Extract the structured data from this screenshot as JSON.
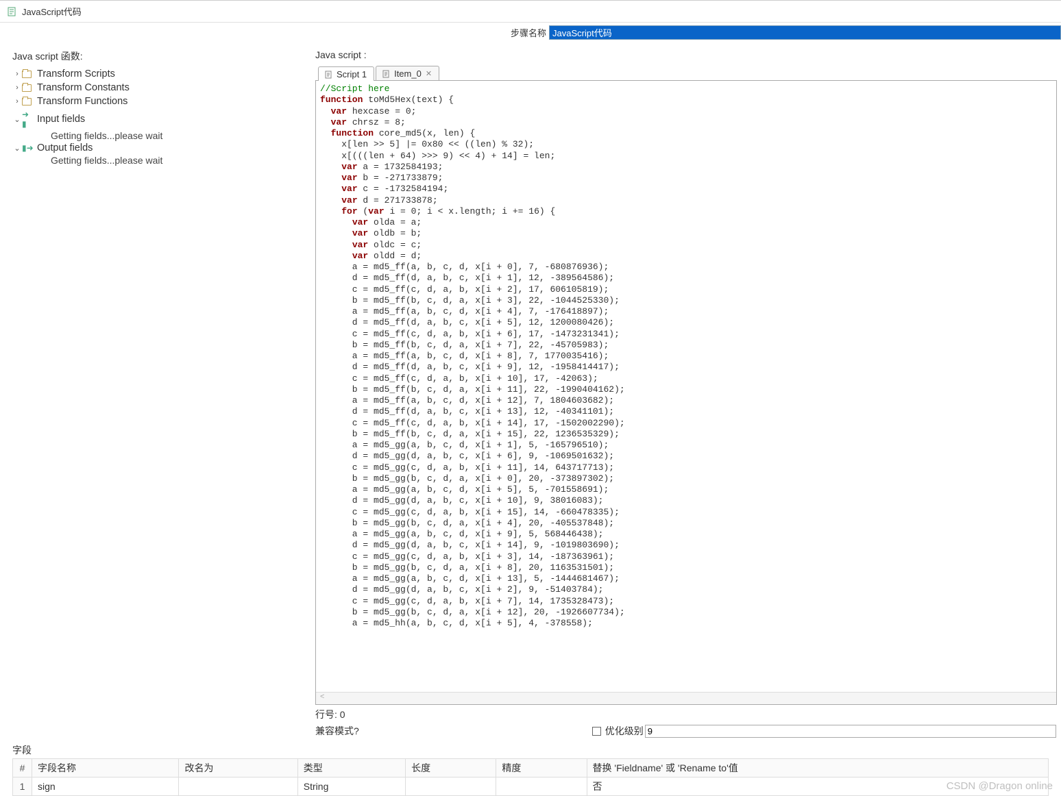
{
  "window": {
    "title": "JavaScript代码"
  },
  "step": {
    "label": "步骤名称",
    "value": "JavaScript代码"
  },
  "left": {
    "heading": "Java script 函数:",
    "tree": [
      {
        "label": "Transform Scripts",
        "expanded": false,
        "type": "folder"
      },
      {
        "label": "Transform Constants",
        "expanded": false,
        "type": "folder"
      },
      {
        "label": "Transform Functions",
        "expanded": false,
        "type": "folder"
      },
      {
        "label": "Input fields",
        "expanded": true,
        "type": "input",
        "child": "Getting fields...please wait"
      },
      {
        "label": "Output fields",
        "expanded": true,
        "type": "output",
        "child": "Getting fields...please wait"
      }
    ]
  },
  "right": {
    "heading": "Java script :",
    "tabs": [
      {
        "label": "Script 1",
        "active": true,
        "closable": false
      },
      {
        "label": "Item_0",
        "active": false,
        "closable": true
      }
    ],
    "code_lines": [
      {
        "t": "//Script here",
        "cls": "c-comment"
      },
      {
        "t": "",
        "cls": ""
      },
      {
        "t": "function toMd5Hex(text) {",
        "cls": "kw-line",
        "kw": "function"
      },
      {
        "t": "  var hexcase = 0;",
        "cls": "kw-line",
        "kw": "var"
      },
      {
        "t": "  var chrsz = 8;",
        "cls": "kw-line",
        "kw": "var"
      },
      {
        "t": "",
        "cls": ""
      },
      {
        "t": "  function core_md5(x, len) {",
        "cls": "kw-line",
        "kw": "function"
      },
      {
        "t": "    x[len >> 5] |= 0x80 << ((len) % 32);",
        "cls": ""
      },
      {
        "t": "    x[(((len + 64) >>> 9) << 4) + 14] = len;",
        "cls": ""
      },
      {
        "t": "    var a = 1732584193;",
        "cls": "kw-line",
        "kw": "var"
      },
      {
        "t": "    var b = -271733879;",
        "cls": "kw-line",
        "kw": "var"
      },
      {
        "t": "    var c = -1732584194;",
        "cls": "kw-line",
        "kw": "var"
      },
      {
        "t": "    var d = 271733878;",
        "cls": "kw-line",
        "kw": "var"
      },
      {
        "t": "    for (var i = 0; i < x.length; i += 16) {",
        "cls": "kw-line",
        "kw": "for"
      },
      {
        "t": "      var olda = a;",
        "cls": "kw-line",
        "kw": "var"
      },
      {
        "t": "      var oldb = b;",
        "cls": "kw-line",
        "kw": "var"
      },
      {
        "t": "      var oldc = c;",
        "cls": "kw-line",
        "kw": "var"
      },
      {
        "t": "      var oldd = d;",
        "cls": "kw-line",
        "kw": "var"
      },
      {
        "t": "      a = md5_ff(a, b, c, d, x[i + 0], 7, -680876936);",
        "cls": ""
      },
      {
        "t": "      d = md5_ff(d, a, b, c, x[i + 1], 12, -389564586);",
        "cls": ""
      },
      {
        "t": "      c = md5_ff(c, d, a, b, x[i + 2], 17, 606105819);",
        "cls": ""
      },
      {
        "t": "      b = md5_ff(b, c, d, a, x[i + 3], 22, -1044525330);",
        "cls": ""
      },
      {
        "t": "      a = md5_ff(a, b, c, d, x[i + 4], 7, -176418897);",
        "cls": ""
      },
      {
        "t": "      d = md5_ff(d, a, b, c, x[i + 5], 12, 1200080426);",
        "cls": ""
      },
      {
        "t": "      c = md5_ff(c, d, a, b, x[i + 6], 17, -1473231341);",
        "cls": ""
      },
      {
        "t": "      b = md5_ff(b, c, d, a, x[i + 7], 22, -45705983);",
        "cls": ""
      },
      {
        "t": "      a = md5_ff(a, b, c, d, x[i + 8], 7, 1770035416);",
        "cls": ""
      },
      {
        "t": "      d = md5_ff(d, a, b, c, x[i + 9], 12, -1958414417);",
        "cls": ""
      },
      {
        "t": "      c = md5_ff(c, d, a, b, x[i + 10], 17, -42063);",
        "cls": ""
      },
      {
        "t": "      b = md5_ff(b, c, d, a, x[i + 11], 22, -1990404162);",
        "cls": ""
      },
      {
        "t": "      a = md5_ff(a, b, c, d, x[i + 12], 7, 1804603682);",
        "cls": ""
      },
      {
        "t": "      d = md5_ff(d, a, b, c, x[i + 13], 12, -40341101);",
        "cls": ""
      },
      {
        "t": "      c = md5_ff(c, d, a, b, x[i + 14], 17, -1502002290);",
        "cls": ""
      },
      {
        "t": "      b = md5_ff(b, c, d, a, x[i + 15], 22, 1236535329);",
        "cls": ""
      },
      {
        "t": "      a = md5_gg(a, b, c, d, x[i + 1], 5, -165796510);",
        "cls": ""
      },
      {
        "t": "      d = md5_gg(d, a, b, c, x[i + 6], 9, -1069501632);",
        "cls": ""
      },
      {
        "t": "      c = md5_gg(c, d, a, b, x[i + 11], 14, 643717713);",
        "cls": ""
      },
      {
        "t": "      b = md5_gg(b, c, d, a, x[i + 0], 20, -373897302);",
        "cls": ""
      },
      {
        "t": "      a = md5_gg(a, b, c, d, x[i + 5], 5, -701558691);",
        "cls": ""
      },
      {
        "t": "      d = md5_gg(d, a, b, c, x[i + 10], 9, 38016083);",
        "cls": ""
      },
      {
        "t": "      c = md5_gg(c, d, a, b, x[i + 15], 14, -660478335);",
        "cls": ""
      },
      {
        "t": "      b = md5_gg(b, c, d, a, x[i + 4], 20, -405537848);",
        "cls": ""
      },
      {
        "t": "      a = md5_gg(a, b, c, d, x[i + 9], 5, 568446438);",
        "cls": ""
      },
      {
        "t": "      d = md5_gg(d, a, b, c, x[i + 14], 9, -1019803690);",
        "cls": ""
      },
      {
        "t": "      c = md5_gg(c, d, a, b, x[i + 3], 14, -187363961);",
        "cls": ""
      },
      {
        "t": "      b = md5_gg(b, c, d, a, x[i + 8], 20, 1163531501);",
        "cls": ""
      },
      {
        "t": "      a = md5_gg(a, b, c, d, x[i + 13], 5, -1444681467);",
        "cls": ""
      },
      {
        "t": "      d = md5_gg(d, a, b, c, x[i + 2], 9, -51403784);",
        "cls": ""
      },
      {
        "t": "      c = md5_gg(c, d, a, b, x[i + 7], 14, 1735328473);",
        "cls": ""
      },
      {
        "t": "      b = md5_gg(b, c, d, a, x[i + 12], 20, -1926607734);",
        "cls": ""
      },
      {
        "t": "      a = md5_hh(a, b, c, d, x[i + 5], 4, -378558);",
        "cls": ""
      }
    ],
    "line_label": "行号: 0",
    "compat_label": "兼容模式?",
    "opt_label": "优化级别",
    "opt_value": "9"
  },
  "fields": {
    "heading": "字段",
    "columns": [
      "#",
      "字段名称",
      "改名为",
      "类型",
      "长度",
      "精度",
      "替换 'Fieldname' 或 'Rename to'值"
    ],
    "rows": [
      {
        "num": "1",
        "name": "sign",
        "rename": "",
        "type": "String",
        "len": "",
        "prec": "",
        "replace": "否"
      }
    ]
  },
  "watermark": "CSDN @Dragon online"
}
